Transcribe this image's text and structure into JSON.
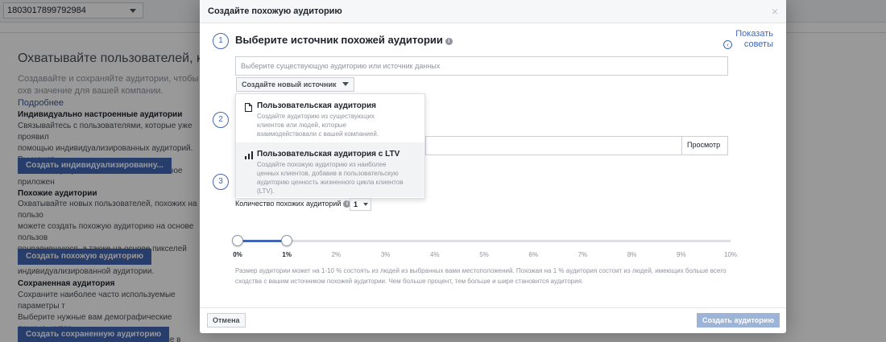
{
  "background": {
    "account_id": "1803017899792984",
    "headline": "Охватывайте пользователей, кото",
    "lead_text": "Создавайте и сохраняйте аудитории, чтобы охв значение для вашей компании.",
    "lead_link": "Подробнее",
    "sections": [
      {
        "title": "Индивидуально настроенные аудитории",
        "text": "Связывайтесь с пользователями, которые уже проявил\nпомощью индивидуализированных аудиторий. Вы может\nклиентов, трафик веб-сайта или мобильное приложен",
        "button": "Создать индивидуализированну..."
      },
      {
        "title": "Похожие аудитории",
        "text": "Охватывайте новых пользователей, похожих на пользо\nможете создать похожую аудиторию на основе пользов\nпонравившуюся, а также на основе пикселей конверси\nиндивидуализированной аудитории.",
        "button": "Создать похожую аудиторию"
      },
      {
        "title": "Сохраненная аудитория",
        "text": "Сохраните наиболее часто используемые параметры т\nВыберите нужные вам демографические данные, интер\nдля повторного использования в рекламе в будущем.",
        "button": "Создать сохраненную аудиторию"
      }
    ]
  },
  "dialog": {
    "title": "Создайте похожую аудиторию",
    "close_glyph": "×",
    "steps": [
      "1",
      "2",
      "3"
    ],
    "source_title": "Выберите источник похожей аудитории",
    "info_glyph": "i",
    "show_tips": "Показать советы",
    "source_placeholder": "Выберите существующую аудиторию или источник данных",
    "create_source_label": "Создайте новый источник",
    "browse_label": "Просмотр",
    "dropdown": [
      {
        "icon": "document-icon",
        "title": "Пользовательская аудитория",
        "desc": "Создайте аудиторию из существующих\nклиентов или людей, которые\nвзаимодействовали с вашей компанией."
      },
      {
        "icon": "bar-chart-icon",
        "title": "Пользовательская аудитория с LTV",
        "desc": "Создайте похожую аудиторию из наиболее\nценных клиентов, добавив в пользовательскую\nаудиторию ценность жизненного цикла клиентов\n(LTV)."
      }
    ],
    "count_label": "Количество похожих аудиторий",
    "count_value": "1",
    "slider": {
      "ticks": [
        "0%",
        "1%",
        "2%",
        "3%",
        "4%",
        "5%",
        "6%",
        "7%",
        "8%",
        "9%",
        "10%"
      ],
      "range_start_percent": 0,
      "range_end_percent": 1
    },
    "size_note": "Размер аудитории может на 1-10 % состоять из людей из выбранных вами местоположений. Похожая на 1 % аудитория состоит из людей, имеющих больше всего сходства с вашим источником похожей аудитории. Чем больше процент, тем больше и шире становится аудитория.",
    "cancel_label": "Отмена",
    "submit_label": "Создать аудиторию"
  },
  "colors": {
    "accent": "#4267b2",
    "disabled_button": "#9cb4d8"
  }
}
